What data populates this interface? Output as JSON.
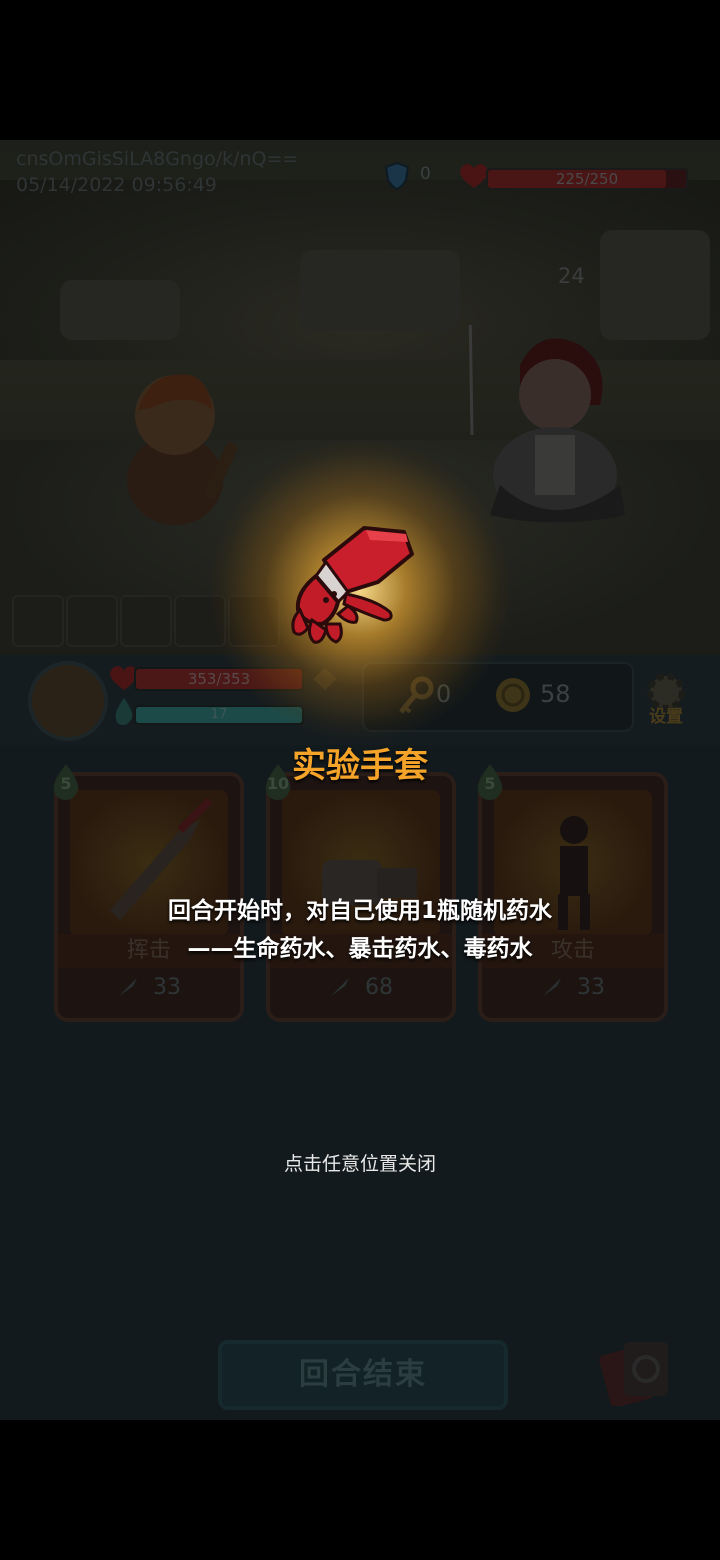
{
  "debug": {
    "id_text": "cnsOmGisSiLA8Gngo/k/nQ==",
    "timestamp": "05/14/2022 09:56:49"
  },
  "enemy": {
    "block": "0",
    "hp_text": "225/250",
    "hp_fraction": 0.9,
    "intent_value": "24"
  },
  "player": {
    "hp_text": "353/353",
    "energy_text": "17",
    "keys": "0",
    "coins": "58"
  },
  "settings_label": "设置",
  "cards": [
    {
      "name": "挥击",
      "cost": "5",
      "value": "33"
    },
    {
      "name": "",
      "cost": "10",
      "value": "68"
    },
    {
      "name": "攻击",
      "cost": "5",
      "value": "33"
    }
  ],
  "end_turn_label": "回合结束",
  "popup": {
    "relic_name": "实验手套",
    "desc_line1": "回合开始时，对自己使用1瓶随机药水",
    "desc_line2": "——生命药水、暴击药水、毒药水",
    "close_hint": "点击任意位置关闭"
  },
  "colors": {
    "relic_name": "#f5a429",
    "glow": "#ffe08c",
    "glove_red": "#c91e2b"
  }
}
